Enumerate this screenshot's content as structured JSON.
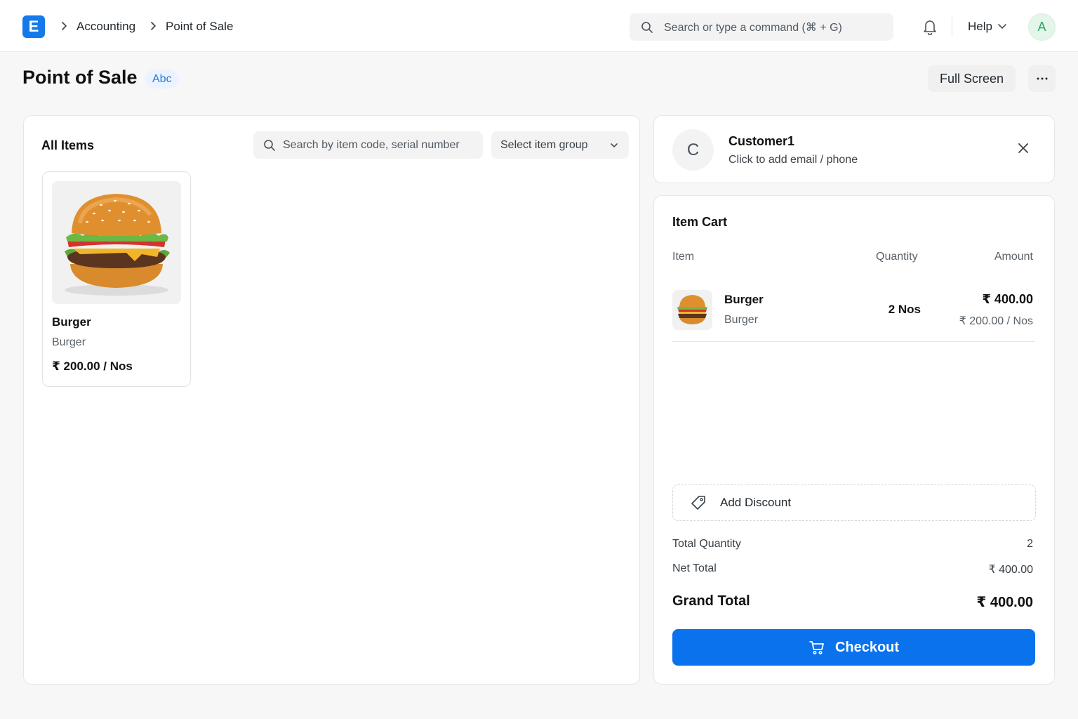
{
  "navbar": {
    "logo_letter": "E",
    "breadcrumbs": [
      "Accounting",
      "Point of Sale"
    ],
    "search_placeholder": "Search or type a command (⌘ + G)",
    "help_label": "Help",
    "avatar_letter": "A"
  },
  "page": {
    "title": "Point of Sale",
    "badge": "Abc",
    "full_screen_label": "Full Screen",
    "more_label": "···"
  },
  "items_panel": {
    "heading": "All Items",
    "search_placeholder": "Search by item code, serial number",
    "group_placeholder": "Select item group",
    "items": [
      {
        "name": "Burger",
        "group": "Burger",
        "price": "₹ 200.00 / Nos"
      }
    ]
  },
  "customer": {
    "avatar_letter": "C",
    "name": "Customer1",
    "contact_prompt": "Click to add email / phone"
  },
  "cart": {
    "heading": "Item Cart",
    "columns": [
      "Item",
      "Quantity",
      "Amount"
    ],
    "rows": [
      {
        "name": "Burger",
        "group": "Burger",
        "qty": "2 Nos",
        "amount": "₹ 400.00",
        "rate": "₹ 200.00 / Nos"
      }
    ],
    "discount_label": "Add Discount",
    "total_quantity_label": "Total Quantity",
    "total_quantity": "2",
    "net_total_label": "Net Total",
    "net_total": "₹ 400.00",
    "grand_total_label": "Grand Total",
    "grand_total": "₹ 400.00",
    "checkout_label": "Checkout"
  },
  "colors": {
    "primary": "#0b72ee",
    "logo": "#1479ea",
    "badge_text": "#2a7ad6",
    "avatar_text": "#30a66d"
  }
}
